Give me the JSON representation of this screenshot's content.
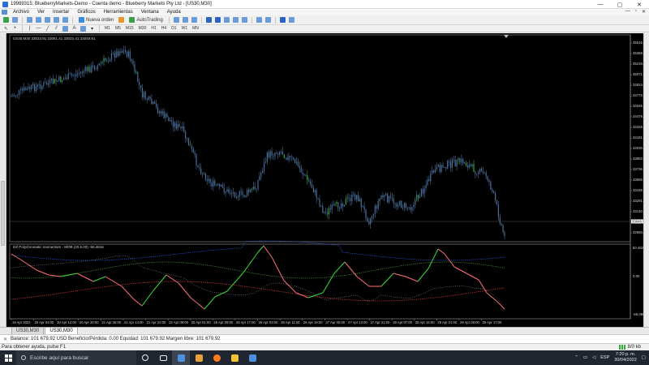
{
  "window": {
    "title": "19989315: BlueberryMarkets-Demo - Cuenta demo - Blueberry Markets Pty Ltd - [US30,M30]",
    "controls": [
      "—",
      "▢",
      "✕"
    ]
  },
  "menu": {
    "items": [
      "Archivo",
      "Ver",
      "Insertar",
      "Gráficos",
      "Herramientas",
      "Ventana",
      "Ayuda"
    ],
    "mdi_controls": [
      "—",
      "▫",
      "✕"
    ]
  },
  "toolbar": {
    "new_order_label": "Nueva orden",
    "autotrading_label": "AutoTrading"
  },
  "timeframes": [
    "M1",
    "M5",
    "M15",
    "M30",
    "H1",
    "H4",
    "D1",
    "W1",
    "MN"
  ],
  "chart": {
    "symbol_header": "US30,M30  33023.91 33061.41 33023.41 33048.91",
    "price_labels": [
      "35516.61",
      "35369.85",
      "35218.05",
      "35071.65",
      "34924.80",
      "34773.50",
      "34626.65",
      "34479.80",
      "34328.50",
      "34181.65",
      "34030.35",
      "33883.50",
      "33736.65",
      "33585.35",
      "33438.50",
      "33291.65",
      "33140.35",
      "33048.91",
      "32993.50"
    ],
    "current_price": "33048.91",
    "indicator_header": "DZ Polychromatic momentum  - MOB (20.5.00) -50.4816",
    "indicator_labels": [
      "50.4824",
      "0.00",
      "-65.0907"
    ],
    "time_labels": [
      "19 Apr 2022",
      "20 Apr 04:00",
      "20 Apr 12:00",
      "20 Apr 20:00",
      "21 Apr 06:00",
      "21 Apr 14:00",
      "21 Apr 22:00",
      "22 Apr 08:00",
      "25 Apr 01:00",
      "25 Apr 09:00",
      "25 Apr 17:00",
      "26 Apr 03:00",
      "26 Apr 11:00",
      "26 Apr 19:00",
      "27 Apr 05:00",
      "27 Apr 13:00",
      "27 Apr 21:00",
      "28 Apr 07:00",
      "28 Apr 15:00",
      "29 Apr 01:00",
      "29 Apr 09:00",
      "29 Apr 17:00"
    ],
    "colors": {
      "candle": "#4a6f9a",
      "bull_highlight": "#2fae3a",
      "momentum_up": "#33e03a",
      "momentum_down": "#ff6f7a",
      "band_upper": "#2a55d6",
      "band_mid": "#4a8b3a",
      "band_lower": "#d33a3a",
      "signal": "#cfcfcf"
    }
  },
  "tabs": [
    "US30,M30",
    "US30,M30"
  ],
  "balance_bar": "Balance: 101 679.92 USD  Beneficio/Pérdida: 0.00  Equidad: 101 679.92  Margen libre: 101 679.92",
  "status": {
    "help": "Para obtener ayuda, pulse F1",
    "traffic": "8/0 kb"
  },
  "taskbar": {
    "search_placeholder": "Escribe aquí para buscar",
    "lang": "ESP",
    "time": "7:20 p. m.",
    "date": "30/04/2022"
  }
}
